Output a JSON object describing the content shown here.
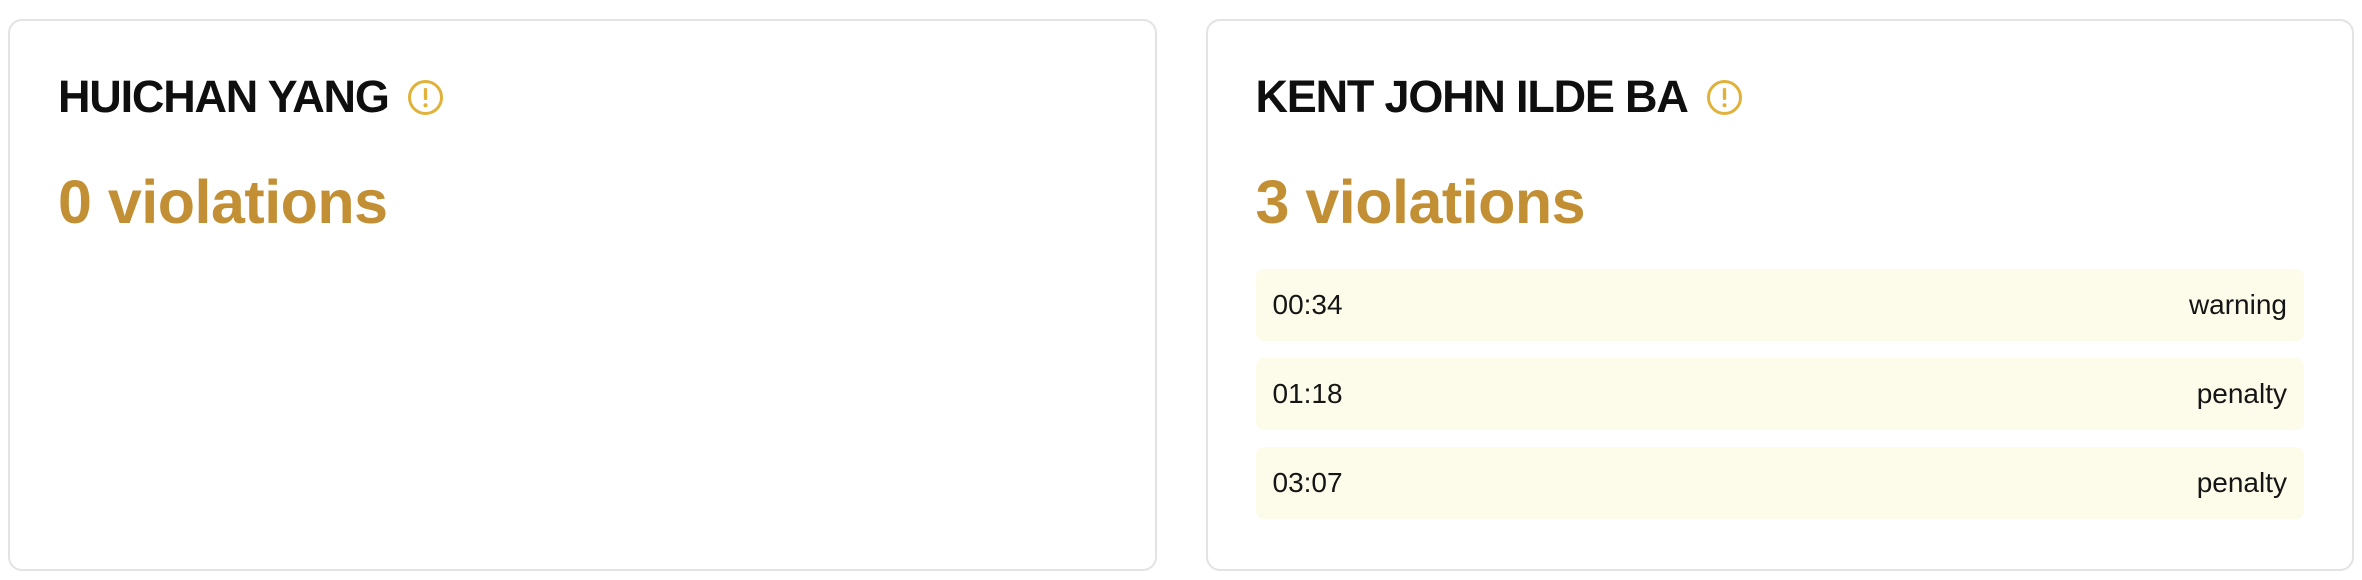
{
  "colors": {
    "accent": "#c28f34",
    "info_icon": "#e0b23a",
    "row_background": "#fdfbe9"
  },
  "cards": [
    {
      "name": "HUICHAN YANG",
      "info_icon": "exclamation-circle-icon",
      "violation_count": "0 violations",
      "violations": []
    },
    {
      "name": "KENT JOHN ILDE BA",
      "info_icon": "exclamation-circle-icon",
      "violation_count": "3 violations",
      "violations": [
        {
          "time": "00:34",
          "type": "warning"
        },
        {
          "time": "01:18",
          "type": "penalty"
        },
        {
          "time": "03:07",
          "type": "penalty"
        }
      ]
    }
  ]
}
